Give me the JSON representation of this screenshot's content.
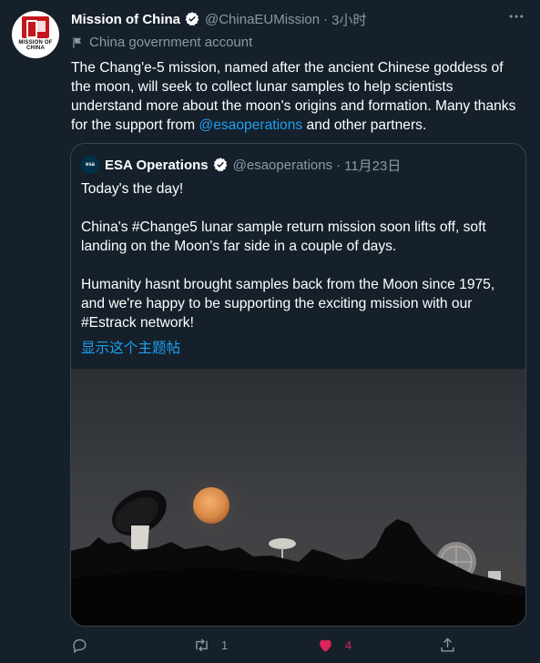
{
  "tweet": {
    "avatar_text": "MISSION OF CHINA",
    "display_name": "Mission of China",
    "handle": "@ChinaEUMission",
    "separator": "·",
    "time": "3小时",
    "label": "China government account",
    "text_before": "The Chang'e-5 mission, named after the ancient Chinese goddess of the moon, will seek to collect lunar samples to help scientists understand more about the moon's origins and formation. Many thanks for the support from ",
    "mention": "@esaoperations",
    "text_after": " and other partners."
  },
  "quoted": {
    "avatar_text": "esa",
    "display_name": "ESA Operations",
    "handle": "@esaoperations",
    "separator": "·",
    "time": "11月23日",
    "paragraphs": [
      "Today's the day!",
      "China's #Change5 lunar sample return mission soon lifts off, soft landing on the Moon's far side in a couple of days.",
      "Humanity hasnt brought samples back from the Moon since 1975, and we're happy to be supporting the exciting mission with our #Estrack network!"
    ],
    "show_thread": "显示这个主题帖"
  },
  "actions": {
    "retweet_count": "1",
    "like_count": "4"
  },
  "colors": {
    "background": "#15202b",
    "accent": "#1da1f2",
    "like": "#e0245e",
    "muted": "#8899a6"
  },
  "icons": [
    "verified-badge-icon",
    "flag-icon",
    "more-icon",
    "reply-icon",
    "retweet-icon",
    "like-icon",
    "share-icon"
  ]
}
